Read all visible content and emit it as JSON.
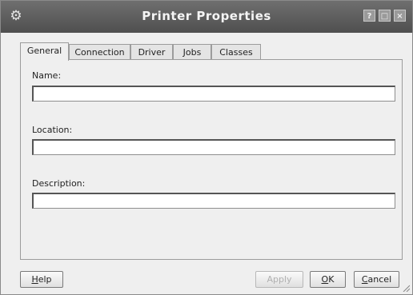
{
  "window": {
    "title": "Printer Properties",
    "icon": "printer-icon",
    "controls": {
      "help": "?",
      "maximize": "□",
      "close": "×"
    }
  },
  "tabs": [
    {
      "label": "General",
      "active": true
    },
    {
      "label": "Connection",
      "active": false
    },
    {
      "label": "Driver",
      "active": false
    },
    {
      "label": "Jobs",
      "active": false
    },
    {
      "label": "Classes",
      "active": false
    }
  ],
  "form": {
    "name_label": "Name:",
    "name_value": "",
    "location_label": "Location:",
    "location_value": "",
    "description_label": "Description:",
    "description_value": ""
  },
  "buttons": {
    "help_first": "H",
    "help_rest": "elp",
    "apply": "Apply",
    "ok_first": "O",
    "ok_rest": "K",
    "cancel_first": "C",
    "cancel_rest": "ancel"
  }
}
